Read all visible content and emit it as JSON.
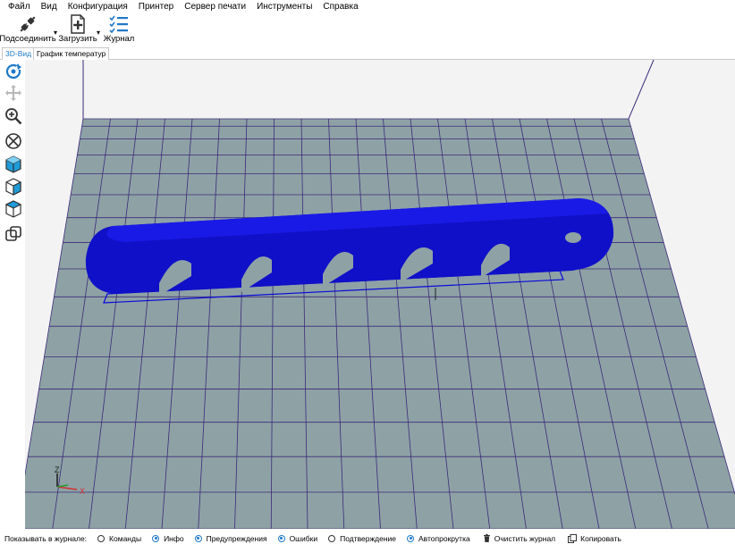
{
  "menu": {
    "items": [
      "Файл",
      "Вид",
      "Конфигурация",
      "Принтер",
      "Сервер печати",
      "Инструменты",
      "Справка"
    ]
  },
  "toolbar": {
    "connect_label": "Подсоединить",
    "load_label": "Загрузить",
    "log_label": "Журнал"
  },
  "tabs": {
    "view3d": "3D-Вид",
    "temp_graph": "График температур"
  },
  "axes": {
    "z": "Z",
    "x": "X"
  },
  "status": {
    "show_in_log_label": "Показывать в журнале:",
    "options": [
      {
        "label": "Команды",
        "checked": false
      },
      {
        "label": "Инфо",
        "checked": true
      },
      {
        "label": "Предупреждения",
        "checked": true
      },
      {
        "label": "Ошибки",
        "checked": true
      },
      {
        "label": "Подтверждение",
        "checked": false
      },
      {
        "label": "Автопрокрутка",
        "checked": true
      }
    ],
    "clear_log_label": "Очистить журнал",
    "copy_label": "Копировать"
  },
  "colors": {
    "accent": "#1f78c8",
    "plate": "#8ea2a5",
    "grid_line": "#3b2a7a",
    "model": "#0a0ad8"
  }
}
